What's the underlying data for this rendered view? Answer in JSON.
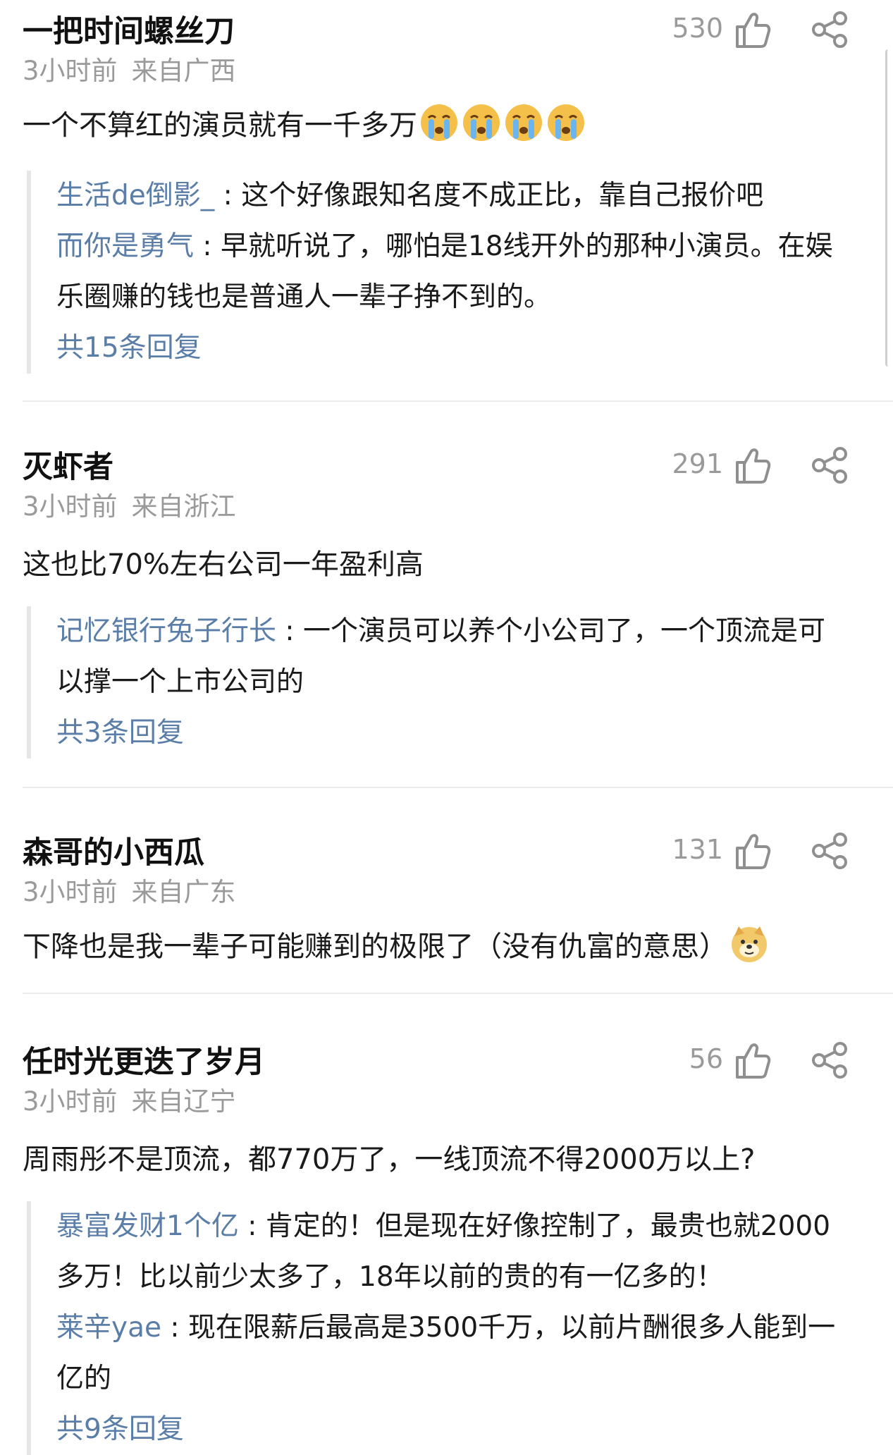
{
  "comments": [
    {
      "username": "一把时间螺丝刀",
      "time": "3小时前",
      "location": "来自广西",
      "likes": "530",
      "text": "一个不算红的演员就有一千多万",
      "emojis": [
        "crying-emoji",
        "crying-emoji",
        "crying-emoji",
        "crying-emoji"
      ],
      "replies": [
        {
          "user": "生活de倒影_",
          "text": "这个好像跟知名度不成正比，靠自己报价吧"
        },
        {
          "user": "而你是勇气",
          "text": "早就听说了，哪怕是18线开外的那种小演员。在娱",
          "text_cont": "乐圈赚的钱也是普通人一辈子挣不到的。"
        }
      ],
      "more": "共15条回复"
    },
    {
      "username": "灭虾者",
      "time": "3小时前",
      "location": "来自浙江",
      "likes": "291",
      "text": "这也比70%左右公司一年盈利高",
      "emojis": [],
      "replies": [
        {
          "user": "记忆银行兔子行长",
          "text": "一个演员可以养个小公司了，一个顶流是可",
          "text_cont": "以撑一个上市公司的"
        }
      ],
      "more": "共3条回复"
    },
    {
      "username": "森哥的小西瓜",
      "time": "3小时前",
      "location": "来自广东",
      "likes": "131",
      "text": "下降也是我一辈子可能赚到的极限了（没有仇富的意思）",
      "emojis": [
        "doge-emoji"
      ],
      "replies": [],
      "more": ""
    },
    {
      "username": "任时光更迭了岁月",
      "time": "3小时前",
      "location": "来自辽宁",
      "likes": "56",
      "text": "周雨彤不是顶流，都770万了，一线顶流不得2000万以上?",
      "emojis": [],
      "replies": [
        {
          "user": "暴富发财1个亿",
          "text": "肯定的！但是现在好像控制了，最贵也就2000",
          "text_cont": "多万！比以前少太多了，18年以前的贵的有一亿多的！"
        },
        {
          "user": "莱辛yae",
          "text": "现在限薪后最高是3500千万，以前片酬很多人能到一",
          "text_cont": "亿的"
        }
      ],
      "more": "共9条回复"
    }
  ],
  "colors": {
    "reply_user": "#5a7ea8",
    "meta": "#9a9a9a",
    "divider": "#ececec",
    "reply_border": "#e6e6e6"
  }
}
